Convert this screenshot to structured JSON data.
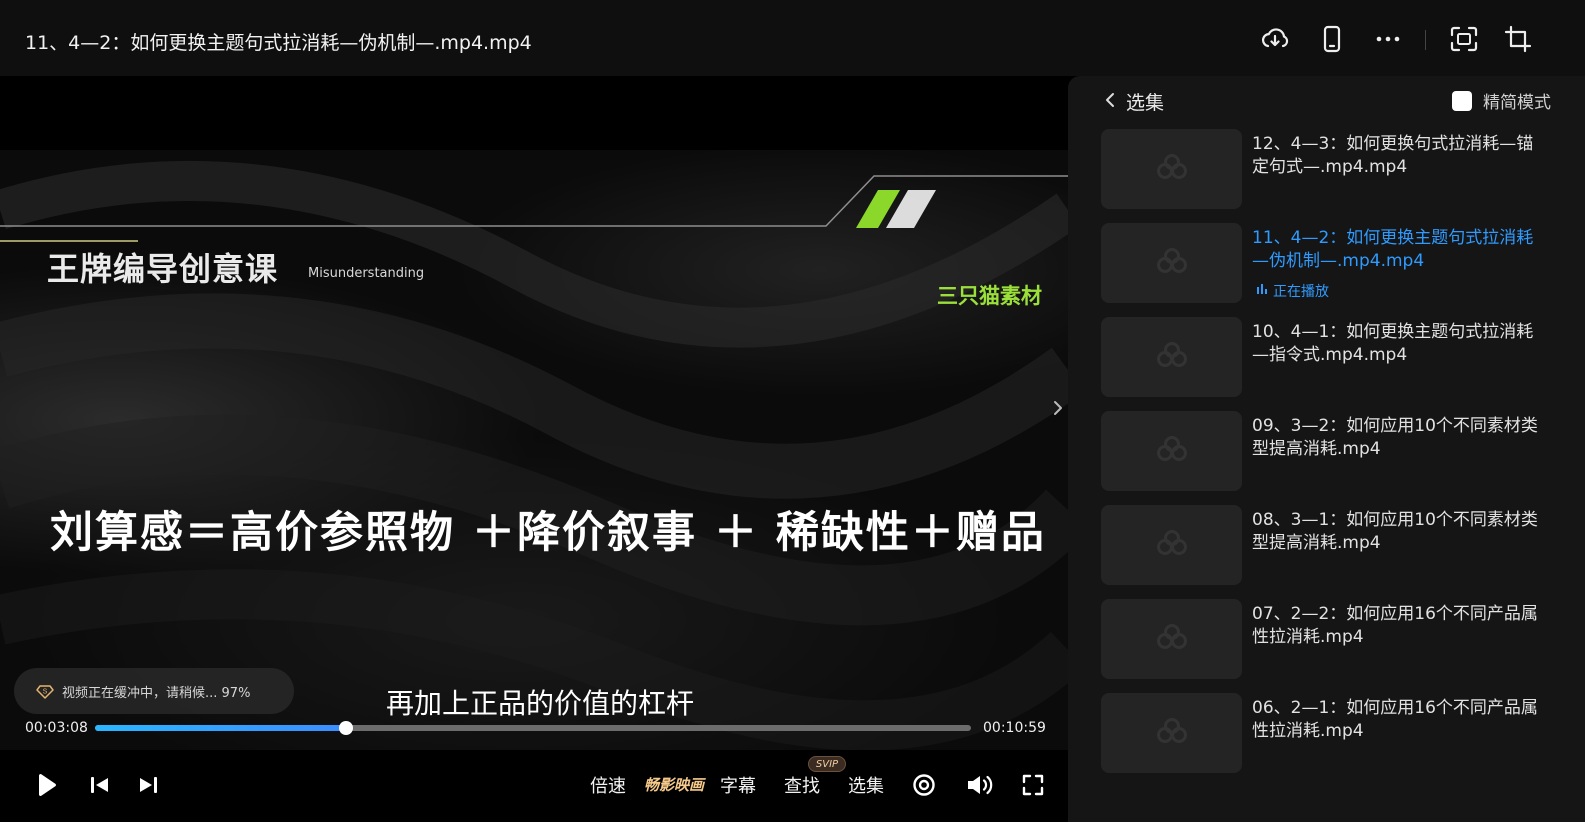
{
  "window": {
    "title": "11、4—2：如何更换主题句式拉消耗—伪机制—.mp4.mp4"
  },
  "top_icons": [
    "cloud-download-icon",
    "mobile-icon",
    "more-icon",
    "screen-cast-icon",
    "crop-icon"
  ],
  "video": {
    "course_title": "王牌编导创意课",
    "course_subtitle": "Misunderstanding",
    "brand": "三只猫素材",
    "headline": "刘算感＝高价参照物 ＋降价叙事 ＋ 稀缺性＋赠品",
    "subtitle": "再加上正品的价值的杠杆",
    "buffer_text": "视频正在缓冲中，请稍候... 97%"
  },
  "player": {
    "current_time": "00:03:08",
    "total_time": "00:10:59",
    "progress_fraction": 0.286,
    "accent_color": "#2bb6ff",
    "controls": {
      "speed_label": "倍速",
      "feature_label": "畅影映画",
      "subtitle_label": "字幕",
      "find_label": "查找",
      "find_badge": "SVIP",
      "episodes_label": "选集"
    }
  },
  "playlist": {
    "title": "选集",
    "mode_label": "精简模式",
    "now_playing_label": "正在播放",
    "active_color": "#2f9bff",
    "items": [
      {
        "name": "12、4—3：如何更换句式拉消耗—锚定句式—.mp4.mp4",
        "active": false
      },
      {
        "name": "11、4—2：如何更换主题句式拉消耗—伪机制—.mp4.mp4",
        "active": true
      },
      {
        "name": "10、4—1：如何更换主题句式拉消耗—指令式.mp4.mp4",
        "active": false
      },
      {
        "name": "09、3—2：如何应用10个不同素材类型提高消耗.mp4",
        "active": false
      },
      {
        "name": "08、3—1：如何应用10个不同素材类型提高消耗.mp4",
        "active": false
      },
      {
        "name": "07、2—2：如何应用16个不同产品属性拉消耗.mp4",
        "active": false
      },
      {
        "name": "06、2—1：如何应用16个不同产品属性拉消耗.mp4",
        "active": false
      }
    ]
  }
}
